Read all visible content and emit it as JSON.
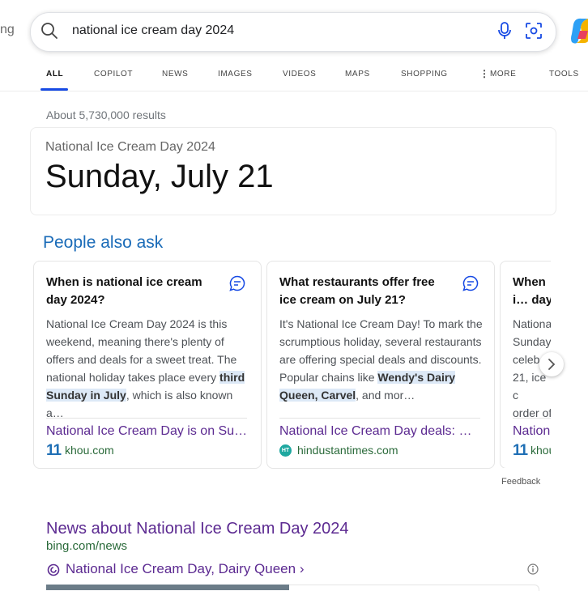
{
  "header": {
    "logo_partial": "ng",
    "search_query": "national ice cream day 2024"
  },
  "tabs": [
    "ALL",
    "COPILOT",
    "NEWS",
    "IMAGES",
    "VIDEOS",
    "MAPS",
    "SHOPPING",
    "MORE",
    "TOOLS"
  ],
  "result_count": "About 5,730,000 results",
  "answer": {
    "label": "National Ice Cream Day 2024",
    "value": "Sunday, July 21"
  },
  "paa": {
    "title": "People also ask",
    "cards": [
      {
        "question": "When is national ice cream day 2024?",
        "body_pre": "National Ice Cream Day 2024 is this weekend, meaning there's plenty of offers and deals for a sweet treat. The national holiday takes place every ",
        "body_hl": "third Sunday in July",
        "body_post": ", which is also known a…",
        "link": "National Ice Cream Day is on Sun…",
        "source": "khou.com",
        "source_icon": "11"
      },
      {
        "question": "What restaurants offer free ice cream on July 21?",
        "body_pre": "It's National Ice Cream Day! To mark the scrumptious holiday, several restaurants are offering special deals and discounts. Popular chains like ",
        "body_hl": "Wendy's Dairy Queen, Carvel",
        "body_post": ", and mor…",
        "link": "National Ice Cream Day deals: W…",
        "source": "hindustantimes.com",
        "source_icon": "HT"
      },
      {
        "question": "When i… day?",
        "body_lines": [
          "Nationa",
          "Sunday",
          "celeb",
          "21, ice c",
          "order of"
        ],
        "link": "Nationa",
        "source": "khou",
        "source_icon": "11"
      }
    ]
  },
  "feedback": "Feedback",
  "news": {
    "title": "News about National Ice Cream Day 2024",
    "source": "bing.com/news",
    "sub": "National Ice Cream Day, Dairy Queen"
  }
}
